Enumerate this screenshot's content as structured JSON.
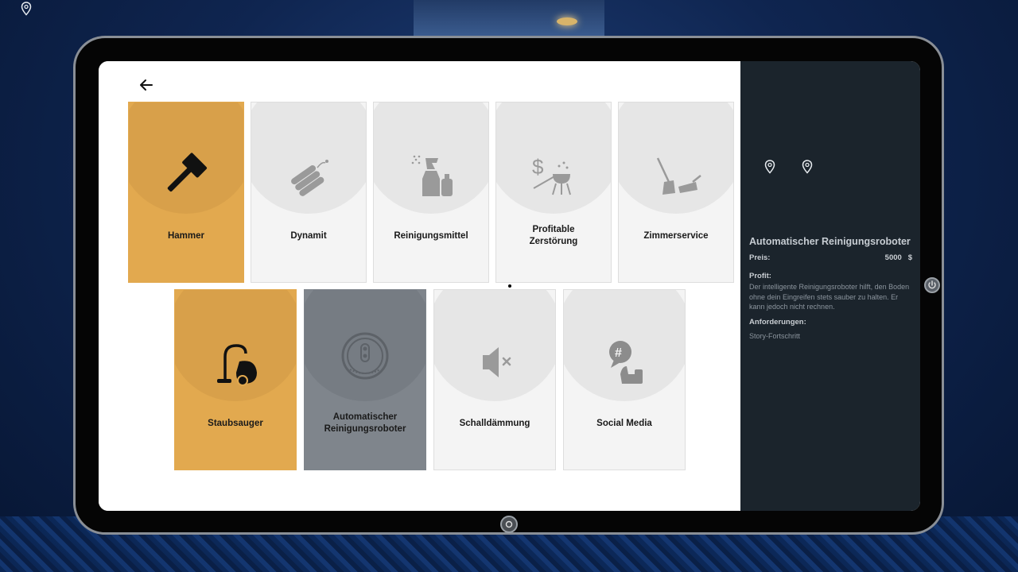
{
  "shop": {
    "items": [
      {
        "label": "Hammer",
        "icon": "hammer-icon",
        "state": "owned"
      },
      {
        "label": "Dynamit",
        "icon": "dynamite-icon",
        "state": "default"
      },
      {
        "label": "Reinigungsmittel",
        "icon": "cleaning-spray-icon",
        "state": "default"
      },
      {
        "label": "Profitable\nZerstörung",
        "icon": "dollar-grill-icon",
        "state": "default"
      },
      {
        "label": "Zimmerservice",
        "icon": "broom-dustpan-icon",
        "state": "default"
      },
      {
        "label": "Staubsauger",
        "icon": "vacuum-icon",
        "state": "owned"
      },
      {
        "label": "Automatischer\nReinigungsroboter",
        "icon": "robot-vacuum-icon",
        "state": "selected"
      },
      {
        "label": "Schalldämmung",
        "icon": "speaker-mute-icon",
        "state": "default"
      },
      {
        "label": "Social Media",
        "icon": "social-hashtag-icon",
        "state": "default"
      }
    ]
  },
  "detail": {
    "title": "Automatischer Reinigungsroboter",
    "price_label": "Preis:",
    "price_value": "5000   $",
    "profit_label": "Profit:",
    "profit_text": "Der intelligente Reinigungsroboter hilft, den Boden ohne dein Eingreifen stets sauber zu halten. Er kann jedoch nicht rechnen.",
    "requirements_label": "Anforderungen:",
    "requirements_text": "Story-Fortschritt"
  },
  "colors": {
    "owned": "#e2a94f",
    "selected": "#7f858c",
    "default": "#f4f4f4",
    "panel": "#1b242c"
  }
}
